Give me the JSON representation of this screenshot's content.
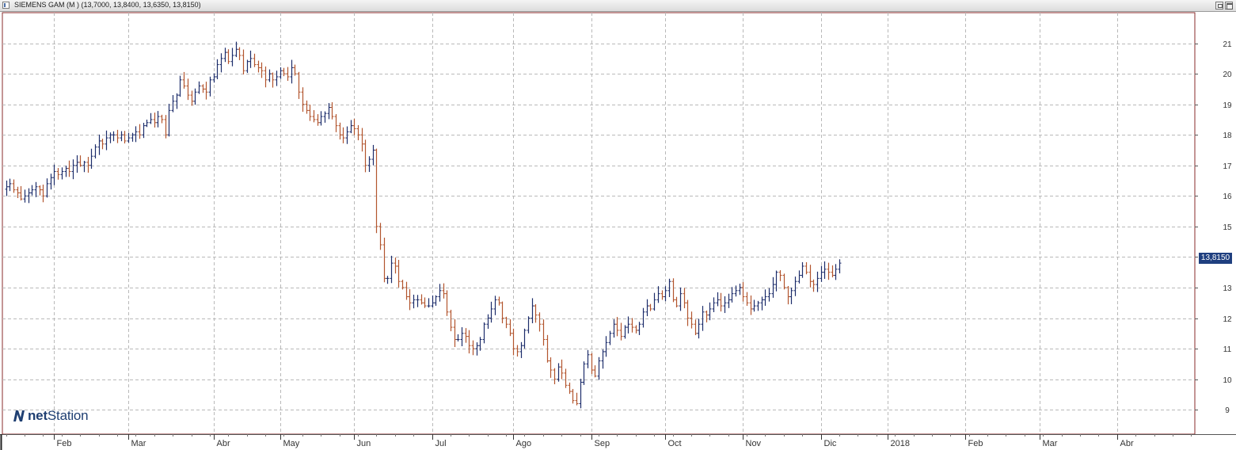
{
  "window": {
    "title": "SIEMENS GAM (M ) (13,7000, 13,8400, 13,6350, 13,8150)",
    "icon": "chart-window-icon",
    "buttons": [
      "restore-icon",
      "maximize-icon"
    ]
  },
  "logo": {
    "brand_bold": "net",
    "brand_regular": "Station",
    "icon": "netstation-logo-icon"
  },
  "colors": {
    "up_bar": "#1d2d6b",
    "down_bar": "#b2552e",
    "grid": "#b9b9b9",
    "frame": "#8a2b2b",
    "last_price_bg": "#1f3f7f"
  },
  "chart_data": {
    "type": "ohlc",
    "title": "SIEMENS GAM (M )",
    "ylim": [
      8.2,
      22.0
    ],
    "y_ticks": [
      9,
      10,
      11,
      12,
      13,
      14,
      15,
      16,
      17,
      18,
      19,
      20,
      21
    ],
    "y_tick_labels": [
      "9",
      "10",
      "11",
      "12",
      "13",
      "14",
      "15",
      "16",
      "17",
      "18",
      "19",
      "20",
      "21"
    ],
    "x_months": [
      {
        "label": "Feb",
        "bar": 13
      },
      {
        "label": "Mar",
        "bar": 33
      },
      {
        "label": "Abr",
        "bar": 56
      },
      {
        "label": "May",
        "bar": 74
      },
      {
        "label": "Jun",
        "bar": 94
      },
      {
        "label": "Jul",
        "bar": 115
      },
      {
        "label": "Ago",
        "bar": 137
      },
      {
        "label": "Sep",
        "bar": 158
      },
      {
        "label": "Oct",
        "bar": 178
      },
      {
        "label": "Nov",
        "bar": 199
      },
      {
        "label": "Dic",
        "bar": 220
      },
      {
        "label": "2018",
        "bar": 238
      },
      {
        "label": "Feb",
        "bar": 259
      },
      {
        "label": "Mar",
        "bar": 279
      },
      {
        "label": "Abr",
        "bar": 300
      }
    ],
    "x_range": [
      -1,
      321
    ],
    "closes": [
      16.3,
      16.4,
      16.2,
      16.1,
      15.9,
      16.0,
      16.1,
      16.2,
      16.3,
      16.2,
      16.0,
      16.4,
      16.6,
      16.8,
      16.7,
      16.8,
      16.9,
      16.8,
      17.0,
      17.1,
      17.0,
      17.1,
      17.0,
      17.3,
      17.6,
      17.8,
      17.7,
      17.9,
      18.0,
      18.0,
      17.9,
      18.0,
      17.8,
      17.9,
      18.0,
      18.1,
      18.0,
      18.3,
      18.4,
      18.5,
      18.4,
      18.6,
      18.5,
      18.0,
      18.8,
      19.1,
      19.3,
      19.8,
      19.6,
      19.3,
      19.1,
      19.4,
      19.6,
      19.5,
      19.4,
      19.8,
      19.9,
      20.3,
      20.5,
      20.7,
      20.4,
      20.6,
      20.8,
      20.6,
      20.1,
      20.4,
      20.5,
      20.3,
      20.2,
      20.1,
      19.8,
      20.0,
      19.8,
      19.9,
      20.1,
      20.0,
      19.9,
      20.2,
      20.0,
      19.4,
      19.0,
      18.8,
      18.6,
      18.5,
      18.4,
      18.6,
      18.7,
      18.9,
      18.6,
      18.3,
      18.0,
      17.9,
      18.1,
      18.3,
      18.2,
      18.0,
      17.7,
      17.0,
      17.2,
      17.5,
      15.0,
      14.4,
      13.3,
      13.3,
      13.8,
      13.7,
      13.2,
      13.0,
      12.7,
      12.5,
      12.6,
      12.6,
      12.5,
      12.4,
      12.4,
      12.5,
      12.7,
      12.9,
      12.8,
      12.2,
      11.7,
      11.3,
      11.3,
      11.5,
      11.4,
      11.1,
      11.0,
      11.1,
      11.3,
      11.8,
      12.0,
      12.3,
      12.6,
      12.5,
      12.0,
      11.8,
      11.5,
      11.0,
      10.9,
      11.1,
      11.6,
      12.0,
      12.4,
      12.1,
      11.8,
      11.3,
      10.6,
      10.3,
      10.0,
      10.4,
      10.2,
      9.8,
      9.6,
      9.3,
      9.2,
      9.9,
      10.5,
      10.8,
      10.3,
      10.1,
      10.6,
      10.9,
      11.2,
      11.5,
      11.8,
      11.6,
      11.4,
      11.7,
      11.8,
      11.7,
      11.6,
      11.8,
      12.2,
      12.4,
      12.3,
      12.6,
      12.8,
      12.7,
      12.9,
      13.2,
      12.6,
      12.4,
      12.8,
      12.5,
      12.0,
      11.8,
      11.5,
      11.8,
      12.2,
      12.1,
      12.3,
      12.5,
      12.6,
      12.4,
      12.5,
      12.6,
      12.8,
      12.9,
      13.0,
      12.7,
      12.5,
      12.3,
      12.4,
      12.5,
      12.6,
      12.7,
      12.8,
      13.1,
      13.5,
      13.4,
      13.0,
      12.7,
      12.9,
      13.2,
      13.4,
      13.7,
      13.5,
      13.2,
      13.1,
      13.3,
      13.5,
      13.6,
      13.5,
      13.4,
      13.6,
      13.8
    ],
    "last_price_label": "13,8150",
    "grid": true
  }
}
